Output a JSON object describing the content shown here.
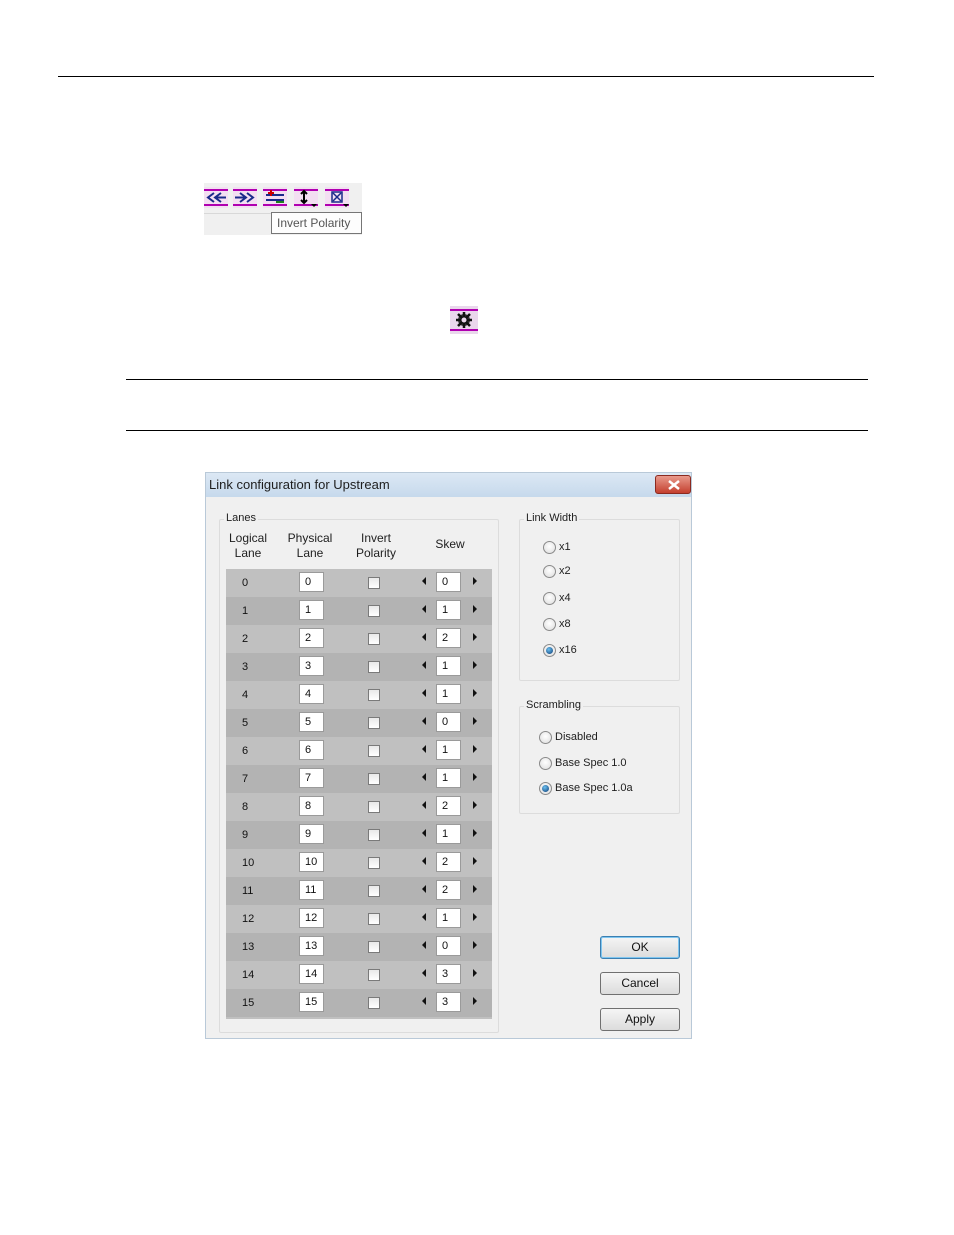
{
  "tooltip": {
    "text": "Invert Polarity"
  },
  "toolbar": {
    "buttons": [
      "move-lanes-left-icon",
      "move-lanes-right-icon",
      "add-lane-icon",
      "invert-polarity-icon",
      "lane-config-icon"
    ]
  },
  "dialog": {
    "title": "Link configuration for Upstream",
    "lanes": {
      "group_label": "Lanes",
      "col_logical": [
        "Logical",
        "Lane"
      ],
      "col_physical": [
        "Physical",
        "Lane"
      ],
      "col_invert": [
        "Invert",
        "Polarity"
      ],
      "col_skew": "Skew",
      "rows": [
        {
          "logical": "0",
          "physical": "0",
          "invert": false,
          "skew": "0"
        },
        {
          "logical": "1",
          "physical": "1",
          "invert": false,
          "skew": "1"
        },
        {
          "logical": "2",
          "physical": "2",
          "invert": false,
          "skew": "2"
        },
        {
          "logical": "3",
          "physical": "3",
          "invert": false,
          "skew": "1"
        },
        {
          "logical": "4",
          "physical": "4",
          "invert": false,
          "skew": "1"
        },
        {
          "logical": "5",
          "physical": "5",
          "invert": false,
          "skew": "0"
        },
        {
          "logical": "6",
          "physical": "6",
          "invert": false,
          "skew": "1"
        },
        {
          "logical": "7",
          "physical": "7",
          "invert": false,
          "skew": "1"
        },
        {
          "logical": "8",
          "physical": "8",
          "invert": false,
          "skew": "2"
        },
        {
          "logical": "9",
          "physical": "9",
          "invert": false,
          "skew": "1"
        },
        {
          "logical": "10",
          "physical": "10",
          "invert": false,
          "skew": "2"
        },
        {
          "logical": "11",
          "physical": "11",
          "invert": false,
          "skew": "2"
        },
        {
          "logical": "12",
          "physical": "12",
          "invert": false,
          "skew": "1"
        },
        {
          "logical": "13",
          "physical": "13",
          "invert": false,
          "skew": "0"
        },
        {
          "logical": "14",
          "physical": "14",
          "invert": false,
          "skew": "3"
        },
        {
          "logical": "15",
          "physical": "15",
          "invert": false,
          "skew": "3"
        }
      ]
    },
    "link_width": {
      "group_label": "Link Width",
      "options": [
        "x1",
        "x2",
        "x4",
        "x8",
        "x16"
      ],
      "selected": "x16"
    },
    "scrambling": {
      "group_label": "Scrambling",
      "options": [
        "Disabled",
        "Base Spec 1.0",
        "Base Spec 1.0a"
      ],
      "selected": "Base Spec 1.0a"
    },
    "buttons": {
      "ok": "OK",
      "cancel": "Cancel",
      "apply": "Apply"
    }
  }
}
